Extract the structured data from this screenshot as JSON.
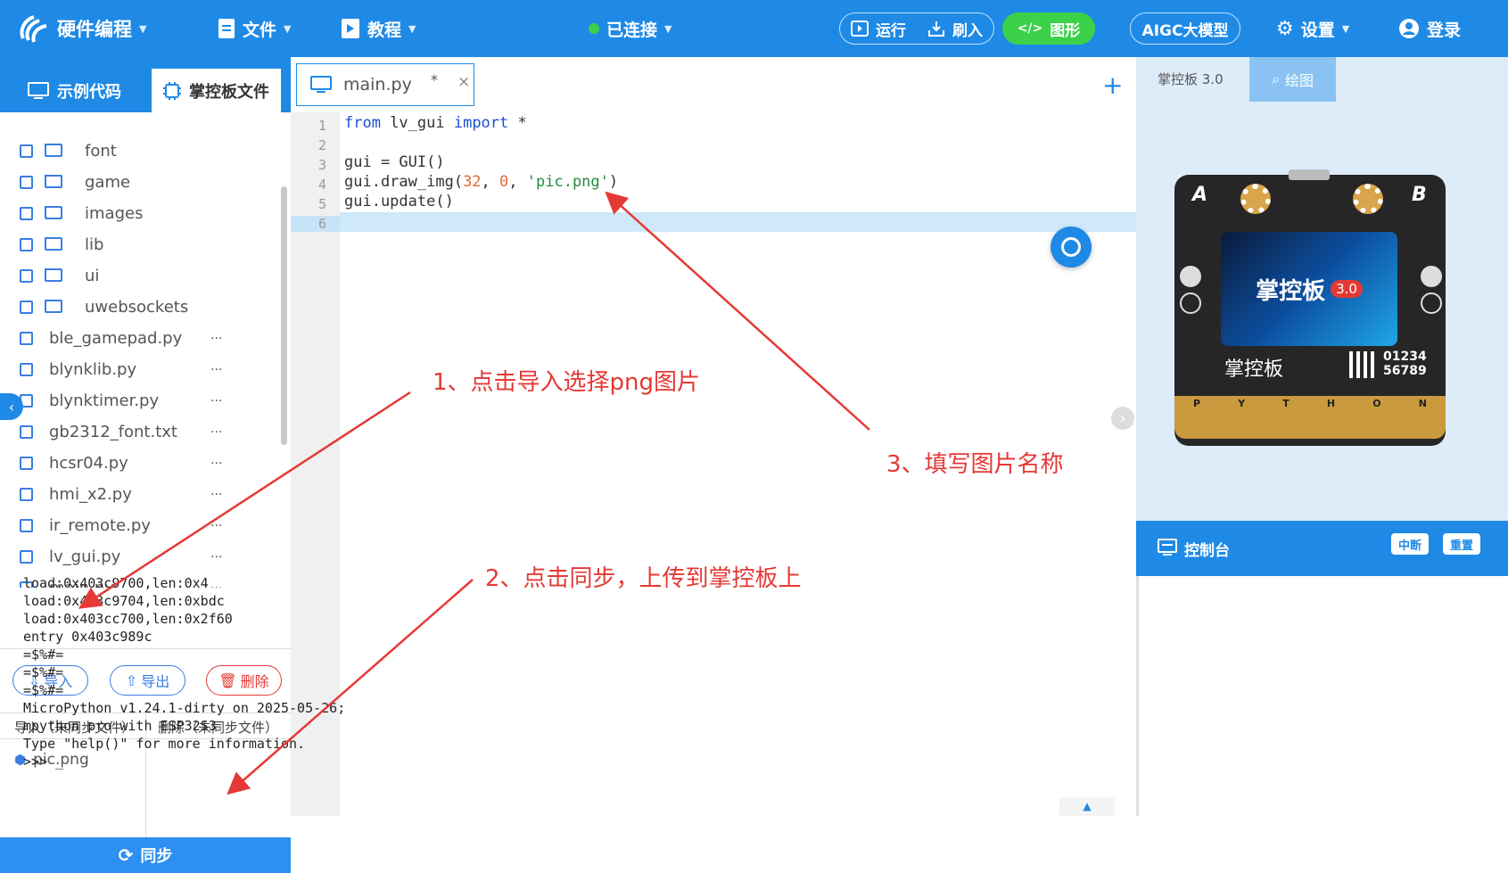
{
  "header": {
    "app_title": "硬件编程",
    "menu_file": "文件",
    "menu_tutorial": "教程",
    "status": "已连接",
    "run": "运行",
    "flash": "刷入",
    "graphics": "图形",
    "aigc": "AIGC大模型",
    "settings": "设置",
    "login": "登录"
  },
  "left_panel": {
    "tabs": [
      "示例代码",
      "掌控板文件"
    ],
    "files": [
      {
        "name": "font",
        "type": "folder"
      },
      {
        "name": "game",
        "type": "folder"
      },
      {
        "name": "images",
        "type": "folder"
      },
      {
        "name": "lib",
        "type": "folder"
      },
      {
        "name": "ui",
        "type": "folder"
      },
      {
        "name": "uwebsockets",
        "type": "folder"
      },
      {
        "name": "ble_gamepad.py",
        "type": "file"
      },
      {
        "name": "blynklib.py",
        "type": "file"
      },
      {
        "name": "blynktimer.py",
        "type": "file"
      },
      {
        "name": "gb2312_font.txt",
        "type": "file"
      },
      {
        "name": "hcsr04.py",
        "type": "file"
      },
      {
        "name": "hmi_x2.py",
        "type": "file"
      },
      {
        "name": "ir_remote.py",
        "type": "file"
      },
      {
        "name": "lv_gui.py",
        "type": "file"
      },
      {
        "name": "main.py",
        "type": "file"
      }
    ],
    "more_label": "···",
    "buttons": {
      "import": "导入",
      "export": "导出",
      "delete": "删除"
    },
    "sync_headers": [
      "导入（未同步文件）",
      "删除（未同步文件）"
    ],
    "pending_file": "pic.png",
    "sync_button": "同步"
  },
  "editor": {
    "tab_name": "main.py",
    "tab_modified": "*",
    "tab_close": "×",
    "add_tab": "+",
    "lines": [
      "1",
      "2",
      "3",
      "4",
      "5",
      "6"
    ]
  },
  "right_panel": {
    "board_tab": "掌控板 3.0",
    "draw_tab": "绘图",
    "console_title": "控制台",
    "interrupt": "中断",
    "reset": "重置",
    "board": {
      "a": "A",
      "b": "B",
      "brand": "掌控板",
      "version": "3.0",
      "bottom_brand": "掌控板",
      "serial1": "01234",
      "serial2": "56789",
      "pins": [
        "P",
        "Y",
        "T",
        "H",
        "O",
        "N"
      ]
    },
    "console_lines": [
      "load:0x403c9700,len:0x4",
      "load:0x403c9704,len:0xbdc",
      "load:0x403cc700,len:0x2f60",
      "entry 0x403c989c",
      "=$%#=",
      "=$%#=",
      "=$%#=",
      "MicroPython v1.24.1-dirty on 2025-05-26; mpython pro with ESP32S3",
      "Type \"help()\" for more information.",
      ">>> _"
    ]
  },
  "annotations": {
    "step1": "1、点击导入选择png图片",
    "step2": "2、点击同步，上传到掌控板上",
    "step3": "3、填写图片名称",
    "color": "#e53935"
  },
  "colors": {
    "primary": "#1e8ae6",
    "green": "#3bd24a",
    "danger": "#e53935"
  }
}
